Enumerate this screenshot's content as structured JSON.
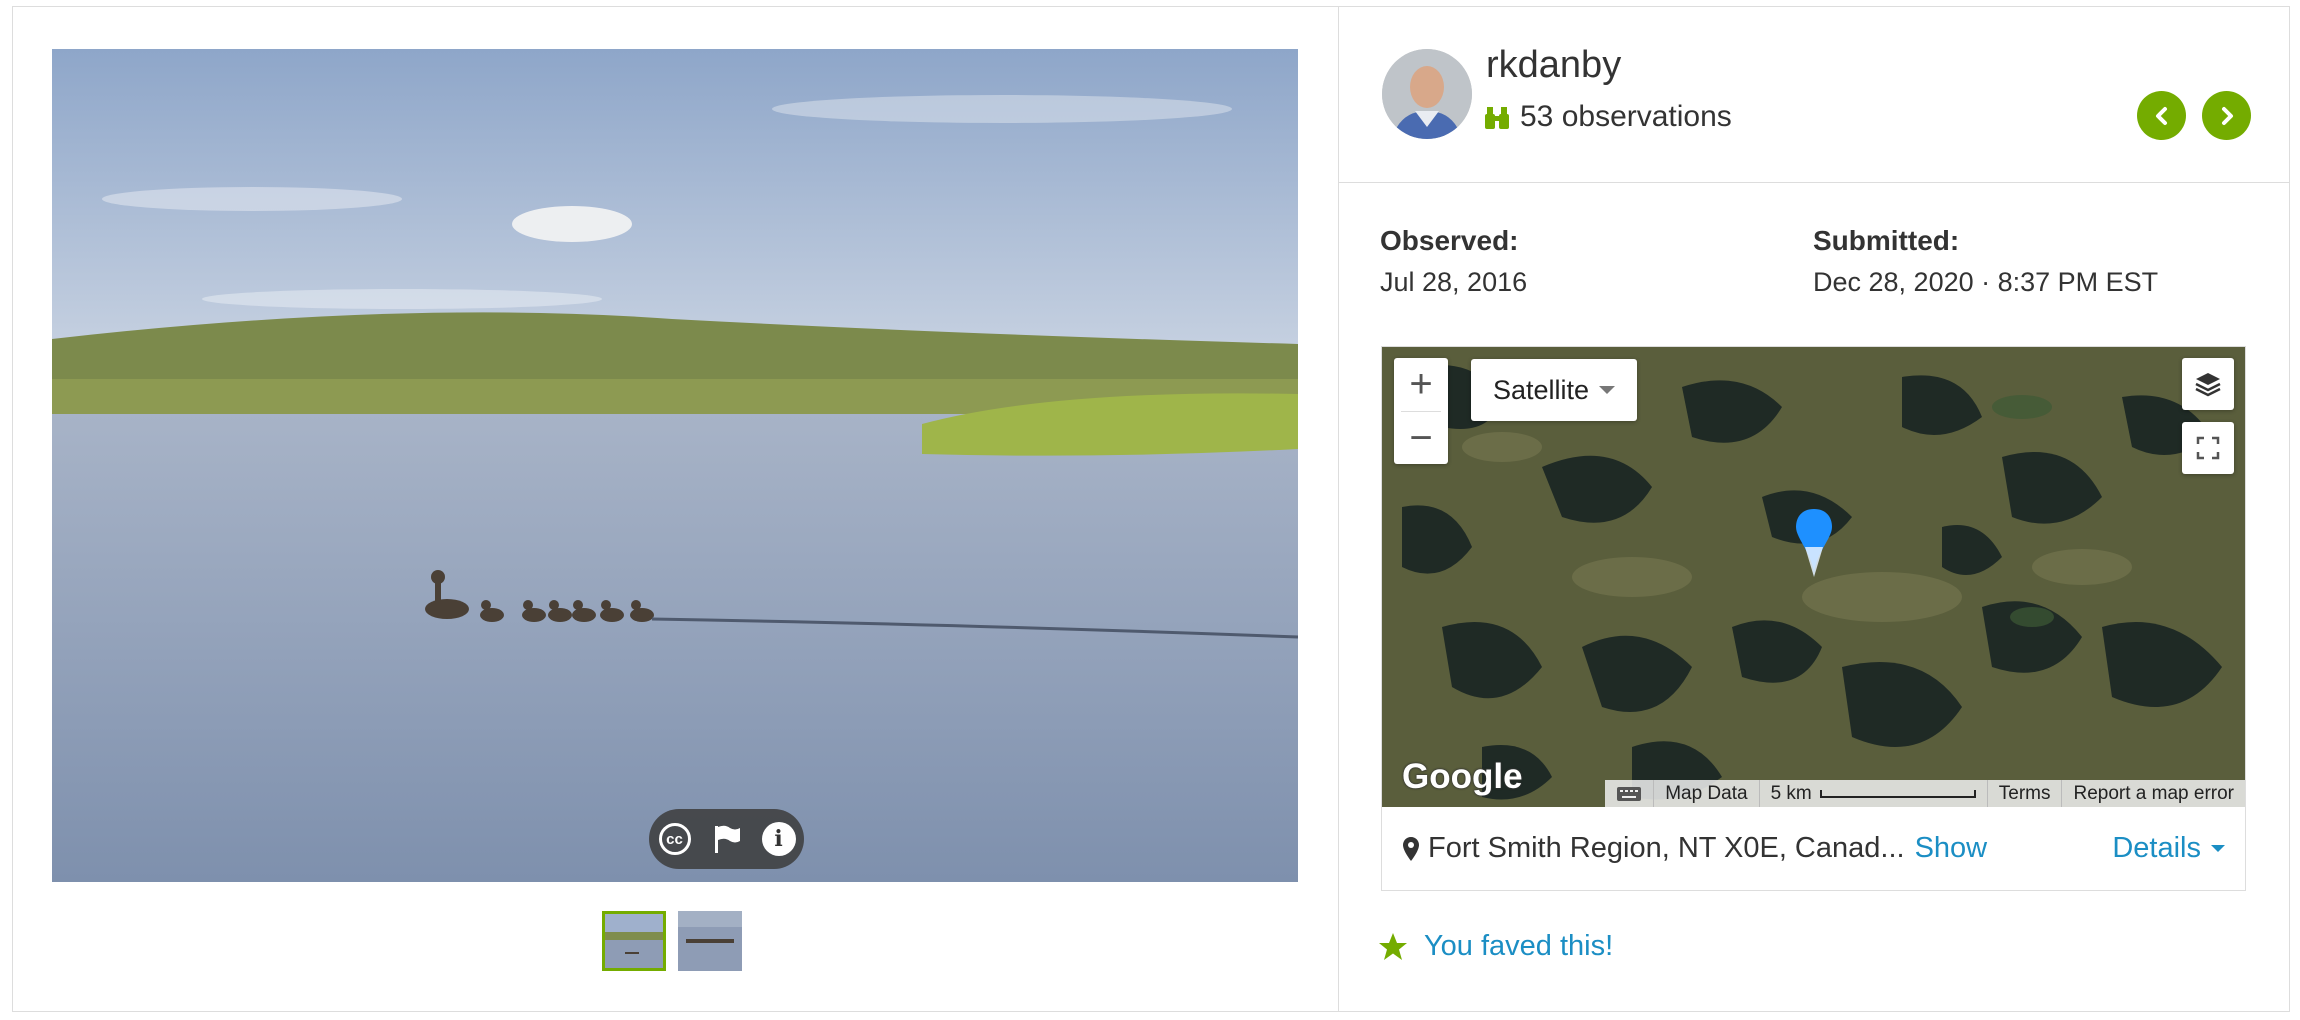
{
  "user": {
    "username": "rkdanby",
    "observations_label": "53 observations"
  },
  "dates": {
    "observed_label": "Observed:",
    "observed_value": "Jul 28, 2016",
    "submitted_label": "Submitted:",
    "submitted_value": "Dec 28, 2020 · 8:37 PM EST"
  },
  "map": {
    "zoom_in": "+",
    "zoom_out": "−",
    "type_selector": "Satellite",
    "logo": "Google",
    "attribution": {
      "map_data": "Map Data",
      "scale": "5 km",
      "terms": "Terms",
      "report": "Report a map error"
    }
  },
  "location": {
    "text": "Fort Smith Region, NT X0E, Canad...",
    "show_link": "Show",
    "details_link": "Details"
  },
  "fave": {
    "text": "You faved this!"
  },
  "photo": {
    "thumbnail_count": 2,
    "active_thumbnail": 1
  },
  "colors": {
    "accent_green": "#74ac00",
    "link_blue": "#1b8ec4",
    "marker_blue": "#1e90ff"
  },
  "icons": {
    "observations": "binoculars-icon",
    "license": "creative-commons-icon",
    "flag": "flag-icon",
    "info": "info-icon",
    "prev": "chevron-left-icon",
    "next": "chevron-right-icon",
    "layers": "layers-icon",
    "fullscreen": "fullscreen-icon",
    "location": "map-pin-icon",
    "fave": "star-icon"
  }
}
